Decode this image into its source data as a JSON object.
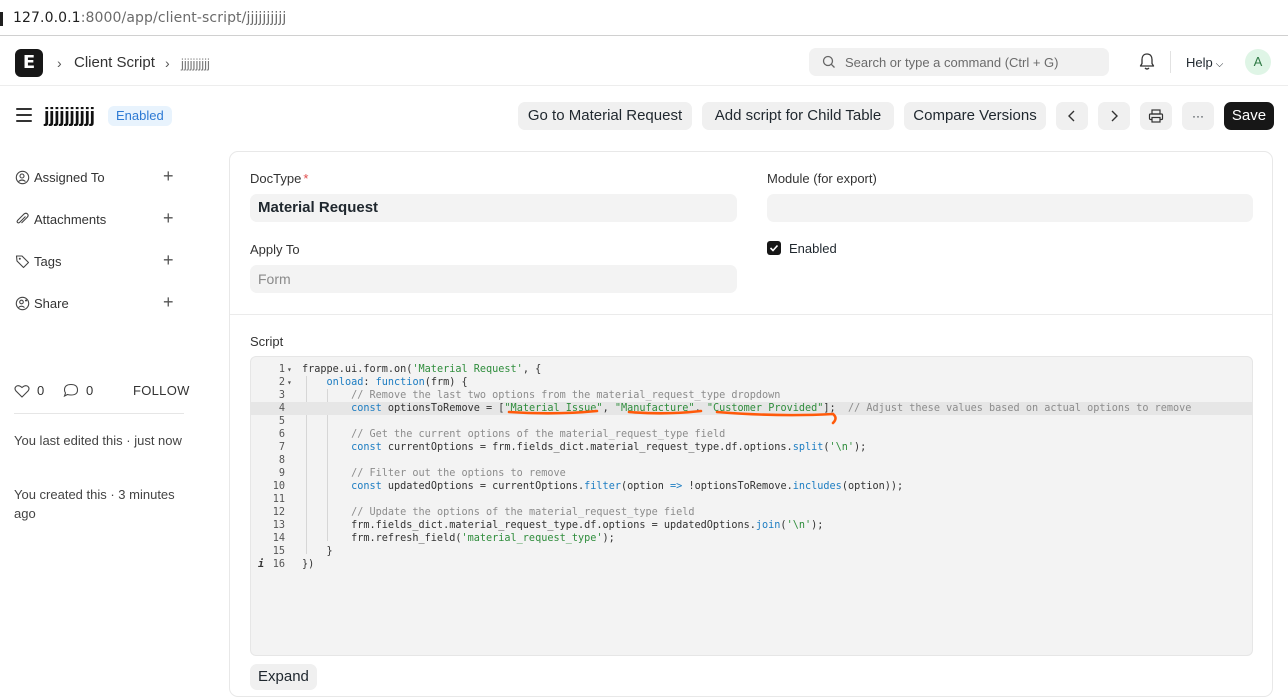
{
  "browser": {
    "url_host": "127.0.0.1",
    "url_rest": ":8000/app/client-script/jjjjjjjjjj"
  },
  "navbar": {
    "logo_letter": "E",
    "breadcrumbs": [
      "Client Script",
      "jjjjjjjjjj"
    ],
    "search_placeholder": "Search or type a command (Ctrl + G)",
    "help_label": "Help",
    "avatar_letter": "A"
  },
  "header": {
    "title": "jjjjjjjjjj",
    "status": "Enabled",
    "buttons": {
      "go_to": "Go to Material Request",
      "add_child": "Add script for Child Table",
      "compare": "Compare Versions",
      "more": "···",
      "save": "Save"
    }
  },
  "sidebar": {
    "items": [
      {
        "label": "Assigned To",
        "icon": "user-assign-icon"
      },
      {
        "label": "Attachments",
        "icon": "paperclip-icon"
      },
      {
        "label": "Tags",
        "icon": "tag-icon"
      },
      {
        "label": "Share",
        "icon": "share-icon"
      }
    ],
    "likes": "0",
    "comments": "0",
    "follow_label": "FOLLOW",
    "last_edited": "You last edited this · just now",
    "created": "You created this · 3 minutes ago"
  },
  "form": {
    "doctype_label": "DocType",
    "doctype_value": "Material Request",
    "module_label": "Module (for export)",
    "module_value": "",
    "apply_to_label": "Apply To",
    "apply_to_placeholder": "Form",
    "enabled_label": "Enabled",
    "enabled_checked": true,
    "script_label": "Script",
    "expand_label": "Expand"
  },
  "code": {
    "lines": [
      "frappe.ui.form.on('Material Request', {",
      "    onload: function(frm) {",
      "        // Remove the last two options from the material_request_type dropdown",
      "        const optionsToRemove = [\"Material Issue\", \"Manufacture\", \"Customer Provided\"];  // Adjust these values based on actual options to remove",
      "",
      "        // Get the current options of the material_request_type field",
      "        const currentOptions = frm.fields_dict.material_request_type.df.options.split('\\n');",
      "",
      "        // Filter out the options to remove",
      "        const updatedOptions = currentOptions.filter(option => !optionsToRemove.includes(option));",
      "",
      "        // Update the options of the material_request_type field",
      "        frm.fields_dict.material_request_type.df.options = updatedOptions.join('\\n');",
      "        frm.refresh_field('material_request_type');",
      "    }",
      "})"
    ],
    "active_line": 4
  },
  "colors": {
    "accent_dark": "#171717",
    "badge_bg": "#e8f3fd",
    "badge_text": "#2d7ad4",
    "annotation": "#ff5a0a"
  }
}
